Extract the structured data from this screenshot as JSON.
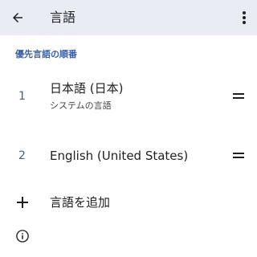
{
  "app_bar": {
    "title": "言語",
    "back_icon": "arrow-back-icon",
    "more_icon": "more-vert-icon"
  },
  "section": {
    "header": "優先言語の順番"
  },
  "languages": [
    {
      "index": "1",
      "name": "日本語 (日本)",
      "subtitle": "システムの言語"
    },
    {
      "index": "2",
      "name": "English (United States)"
    }
  ],
  "add_language": {
    "label": "言語を追加",
    "icon": "plus-icon"
  },
  "footer": {
    "info_icon": "info-icon"
  },
  "colors": {
    "app_bar_bg": "#e9edf3",
    "accent": "#3a5fa8",
    "text": "#1f1f1f"
  }
}
